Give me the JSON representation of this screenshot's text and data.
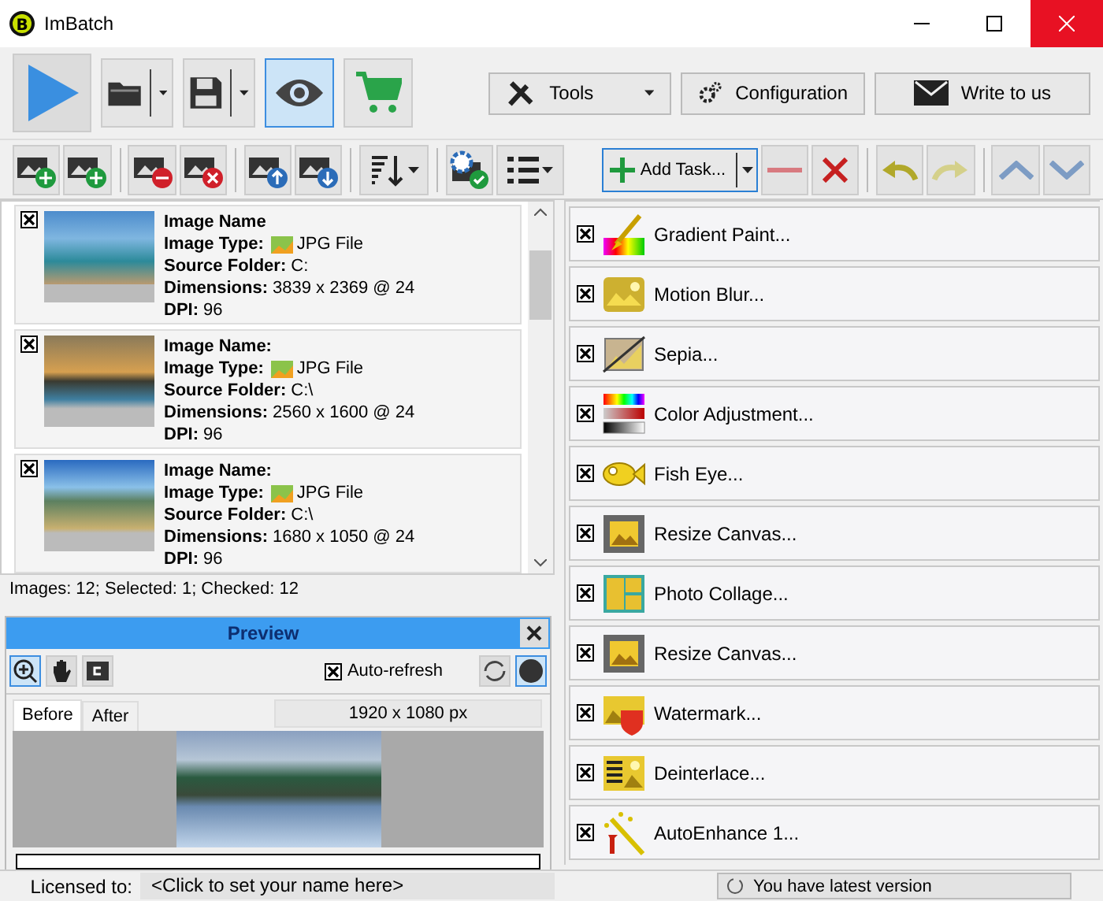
{
  "window": {
    "logo": "B",
    "title": "ImBatch"
  },
  "main_toolbar": {
    "preview_toggle": {
      "on": true
    },
    "buttons": [
      {
        "label": "Tools",
        "dropdown": true
      },
      {
        "label": "Configuration",
        "dropdown": false
      },
      {
        "label": "Write to us",
        "dropdown": false
      }
    ]
  },
  "task_toolbar": {
    "add_task": "Add Task..."
  },
  "images": [
    {
      "checked": true,
      "fields": [
        {
          "label": "Image Name"
        },
        {
          "label": "Image Type:",
          "value": "JPG File",
          "kind": "file_type"
        },
        {
          "label": "Source Folder:",
          "value": "C:"
        },
        {
          "label": "Dimensions:",
          "value": "3839 x 2369 @ 24"
        },
        {
          "label": "DPI:",
          "value": "96"
        }
      ]
    },
    {
      "checked": true,
      "fields": [
        {
          "label": "Image Name:"
        },
        {
          "label": "Image Type:",
          "value": "JPG File",
          "kind": "file_type"
        },
        {
          "label": "Source Folder:",
          "value": "C:\\"
        },
        {
          "label": "Dimensions:",
          "value": "2560 x 1600 @ 24"
        },
        {
          "label": "DPI:",
          "value": "96"
        }
      ]
    },
    {
      "checked": true,
      "fields": [
        {
          "label": "Image Name:"
        },
        {
          "label": "Image Type:",
          "value": "JPG File",
          "kind": "file_type"
        },
        {
          "label": "Source Folder:",
          "value": "C:\\"
        },
        {
          "label": "Dimensions:",
          "value": "1680 x 1050 @ 24"
        },
        {
          "label": "DPI:",
          "value": "96"
        }
      ]
    }
  ],
  "image_status": "Images: 12; Selected: 1; Checked: 12",
  "preview": {
    "title": "Preview",
    "auto_refresh": {
      "label": "Auto-refresh",
      "checked": true
    },
    "tabs": [
      {
        "label": "Before",
        "selected": true
      },
      {
        "label": "After",
        "selected": false
      }
    ],
    "resolution": "1920 x 1080 px",
    "progress": {
      "level": 0
    }
  },
  "tasks": [
    {
      "label": "Gradient Paint...",
      "checked": true
    },
    {
      "label": "Motion Blur...",
      "checked": true
    },
    {
      "label": "Sepia...",
      "checked": true
    },
    {
      "label": "Color Adjustment...",
      "checked": true
    },
    {
      "label": "Fish Eye...",
      "checked": true
    },
    {
      "label": "Resize Canvas...",
      "checked": true
    },
    {
      "label": "Photo Collage...",
      "checked": true
    },
    {
      "label": "Resize Canvas...",
      "checked": true
    },
    {
      "label": "Watermark...",
      "checked": true
    },
    {
      "label": "Deinterlace...",
      "checked": true
    },
    {
      "label": "AutoEnhance 1...",
      "checked": true
    }
  ],
  "status_bar": {
    "license_label": "Licensed to:",
    "license_value": "<Click to set your name here>",
    "update": "You have latest version"
  }
}
